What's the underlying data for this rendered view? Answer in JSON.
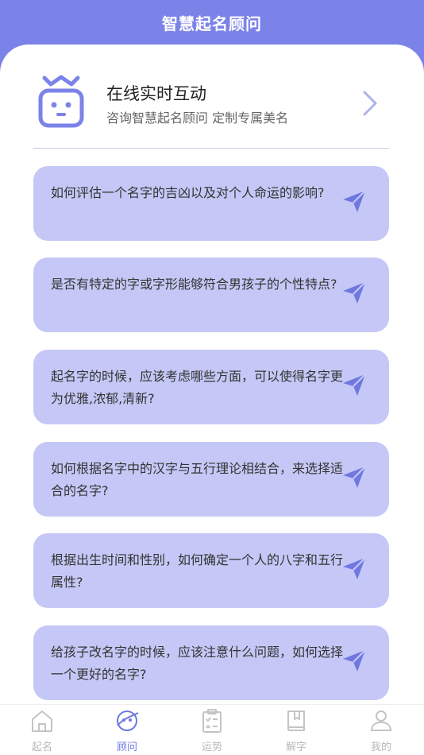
{
  "header": {
    "title": "智慧起名顾问"
  },
  "promo": {
    "title": "在线实时互动",
    "subtitle": "咨询智慧起名顾问 定制专属美名",
    "icon": "robot-icon"
  },
  "questions": [
    {
      "text": "如何评估一个名字的吉凶以及对个人命运的影响?"
    },
    {
      "text": "是否有特定的字或字形能够符合男孩子的个性特点?"
    },
    {
      "text": "起名字的时候，应该考虑哪些方面，可以使得名字更为优雅,浓郁,清新?"
    },
    {
      "text": "如何根据名字中的汉字与五行理论相结合，来选择适合的名字?"
    },
    {
      "text": "根据出生时间和性别，如何确定一个人的八字和五行属性?"
    },
    {
      "text": "给孩子改名字的时候，应该注意什么问题，如何选择一个更好的名字?"
    }
  ],
  "tabs": [
    {
      "label": "起名",
      "icon": "house-icon",
      "active": false
    },
    {
      "label": "顾问",
      "icon": "planet-icon",
      "active": true
    },
    {
      "label": "运势",
      "icon": "checklist-icon",
      "active": false
    },
    {
      "label": "解字",
      "icon": "book-icon",
      "active": false
    },
    {
      "label": "我的",
      "icon": "user-icon",
      "active": false
    }
  ],
  "colors": {
    "header": "#7b83e8",
    "card": "#c5c8f6",
    "accent": "#6f78e0",
    "tab_inactive": "#b9b9b9"
  }
}
